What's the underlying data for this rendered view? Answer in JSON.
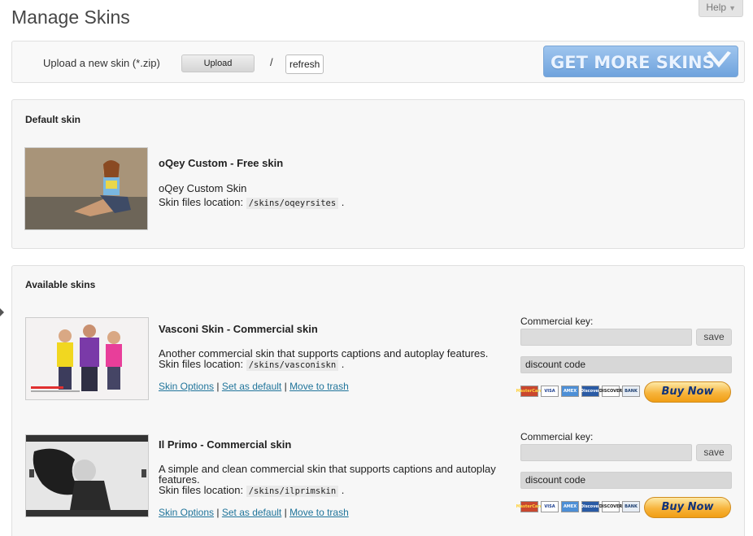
{
  "header": {
    "title": "Manage Skins",
    "help_label": "Help",
    "help_arrow": "▼"
  },
  "upload": {
    "label": "Upload a new skin (*.zip)",
    "upload_button": "Upload",
    "separator": "/",
    "refresh_button": "refresh",
    "promo_text": "GET MORE SKINS"
  },
  "default_skin": {
    "section_title": "Default skin",
    "name": "oQey Custom - Free skin",
    "description": "oQey Custom Skin",
    "location_label": "Skin files location:",
    "location_path": "/skins/oqeyrsites",
    "location_suffix": "."
  },
  "available": {
    "section_title": "Available skins",
    "skins": [
      {
        "name": "Vasconi Skin - Commercial skin",
        "description": "Another commercial skin that supports captions and autoplay features.",
        "location_label": "Skin files location:",
        "location_path": "/skins/vasconiskn",
        "location_suffix": ".",
        "link_options": "Skin Options",
        "link_default": "Set as default",
        "link_trash": "Move to trash",
        "link_sep": "|",
        "key_label": "Commercial key:",
        "save_label": "save",
        "discount_value": "discount code",
        "buy_label": "Buy Now"
      },
      {
        "name": "Il Primo - Commercial skin",
        "description": "A simple and clean commercial skin that supports captions and autoplay features.",
        "location_label": "Skin files location:",
        "location_path": "/skins/ilprimskin",
        "location_suffix": ".",
        "link_options": "Skin Options",
        "link_default": "Set as default",
        "link_trash": "Move to trash",
        "link_sep": "|",
        "key_label": "Commercial key:",
        "save_label": "save",
        "discount_value": "discount code",
        "buy_label": "Buy Now"
      }
    ]
  },
  "payment_cards": [
    {
      "icon": "mastercard-icon",
      "label": "MasterCard",
      "bg": "#c9472f",
      "fg": "#ffd23c"
    },
    {
      "icon": "visa-icon",
      "label": "VISA",
      "bg": "#ffffff",
      "fg": "#1a3d8f"
    },
    {
      "icon": "amex-icon",
      "label": "AMEX",
      "bg": "#4d8fd6",
      "fg": "#ffffff"
    },
    {
      "icon": "discover-icon",
      "label": "Discover",
      "bg": "#2a5ba5",
      "fg": "#ffffff"
    },
    {
      "icon": "discover-network-icon",
      "label": "DISCOVER",
      "bg": "#ffffff",
      "fg": "#222222"
    },
    {
      "icon": "bank-icon",
      "label": "BANK",
      "bg": "#e8eef5",
      "fg": "#1b3d6f"
    }
  ],
  "colors": {
    "link": "#21759b",
    "promo": "#7fb0e6",
    "buy": "#f7b43c"
  }
}
